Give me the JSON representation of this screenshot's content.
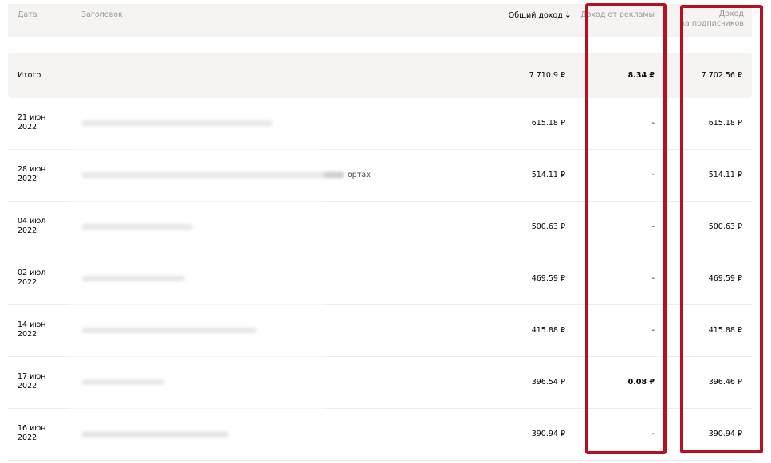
{
  "header": {
    "date": "Дата",
    "title": "Заголовок",
    "total": "Общий доход",
    "ads": "Доход от рекламы",
    "subs_line1": "Доход",
    "subs_line2": "за подписчиков",
    "sort_icon": "arrow-down-icon",
    "sort_glyph": "↓"
  },
  "total_row": {
    "label": "Итого",
    "total": "7 710.9 ₽",
    "ads": "8.34 ₽",
    "subs": "7 702.56 ₽"
  },
  "rows": [
    {
      "date_day": "21 июн",
      "date_year": "2022",
      "title": "",
      "total": "615.18 ₽",
      "ads": "-",
      "subs": "615.18 ₽"
    },
    {
      "date_day": "28 июн",
      "date_year": "2022",
      "title": "ортах",
      "total": "514.11 ₽",
      "ads": "-",
      "subs": "514.11 ₽"
    },
    {
      "date_day": "04 июл",
      "date_year": "2022",
      "title": "",
      "total": "500.63 ₽",
      "ads": "-",
      "subs": "500.63 ₽"
    },
    {
      "date_day": "02 июл",
      "date_year": "2022",
      "title": "",
      "total": "469.59 ₽",
      "ads": "-",
      "subs": "469.59 ₽"
    },
    {
      "date_day": "14 июн",
      "date_year": "2022",
      "title": "",
      "total": "415.88 ₽",
      "ads": "-",
      "subs": "415.88 ₽"
    },
    {
      "date_day": "17 июн",
      "date_year": "2022",
      "title": "",
      "total": "396.54 ₽",
      "ads": "0.08 ₽",
      "subs": "396.46 ₽"
    },
    {
      "date_day": "16 июн",
      "date_year": "2022",
      "title": "",
      "total": "390.94 ₽",
      "ads": "-",
      "subs": "390.94 ₽"
    }
  ],
  "colors": {
    "header_bg": "#f5f4f2",
    "highlight_frame": "#b8101e"
  }
}
